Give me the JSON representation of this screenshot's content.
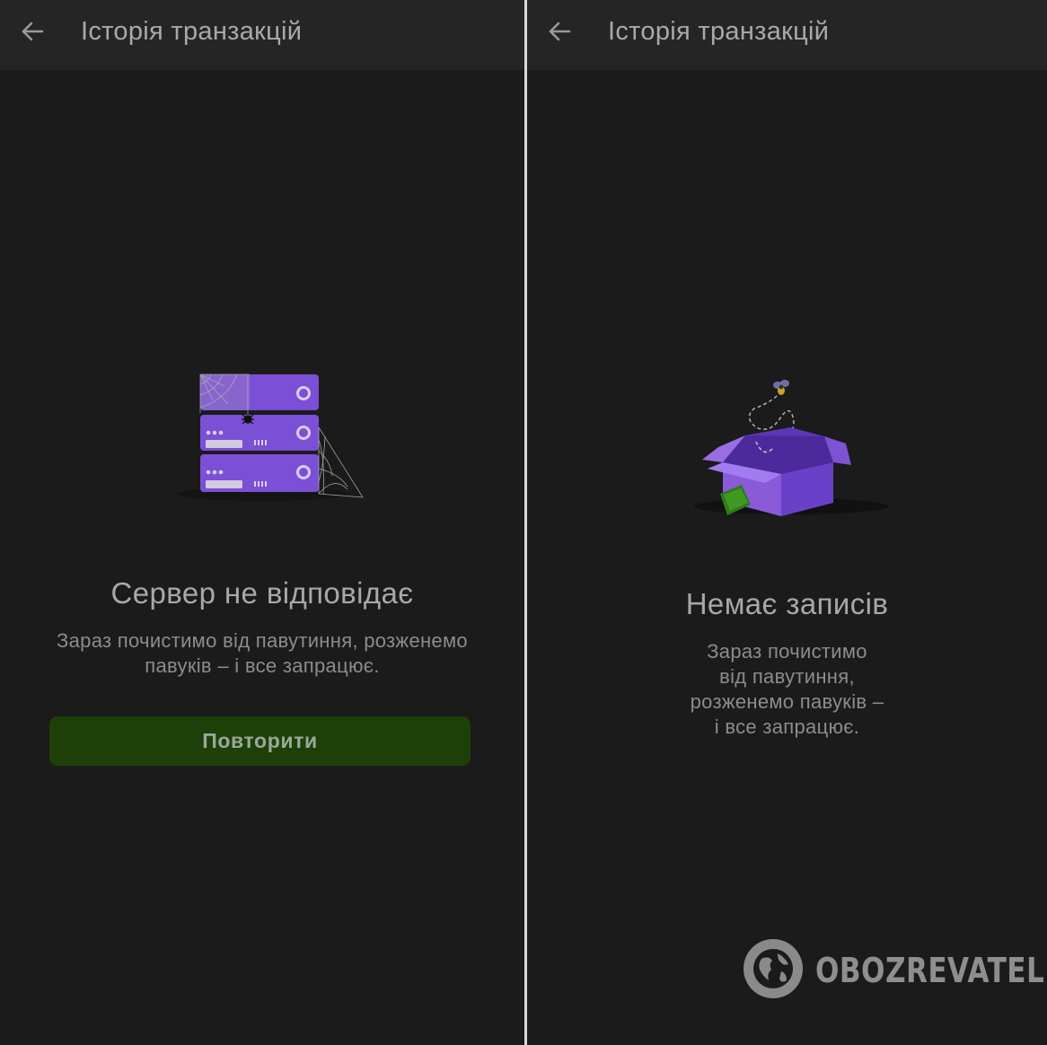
{
  "left_screen": {
    "title": "Історія транзакцій",
    "back_icon": "arrow-left-icon",
    "illustration": "server-rack-with-spider-web",
    "heading": "Сервер не відповідає",
    "message_line1": "Зараз почистимо від павутиння, розженемо",
    "message_line2": "павуків – і все запрацює.",
    "retry_label": "Повторити"
  },
  "right_screen": {
    "title": "Історія транзакцій",
    "back_icon": "arrow-left-icon",
    "illustration": "empty-open-box-with-fly",
    "heading": "Немає записів",
    "message_line1": "Зараз почистимо",
    "message_line2": "від павутиння,",
    "message_line3": "розженемо павуків –",
    "message_line4": "і все запрацює."
  },
  "watermark": {
    "text": "OBOZREVATEL",
    "icon": "globe-logo-icon"
  },
  "colors": {
    "background": "#1b1b1b",
    "appbar": "#252525",
    "accent_purple": "#7b4fd6",
    "button_green": "#1d4009"
  }
}
